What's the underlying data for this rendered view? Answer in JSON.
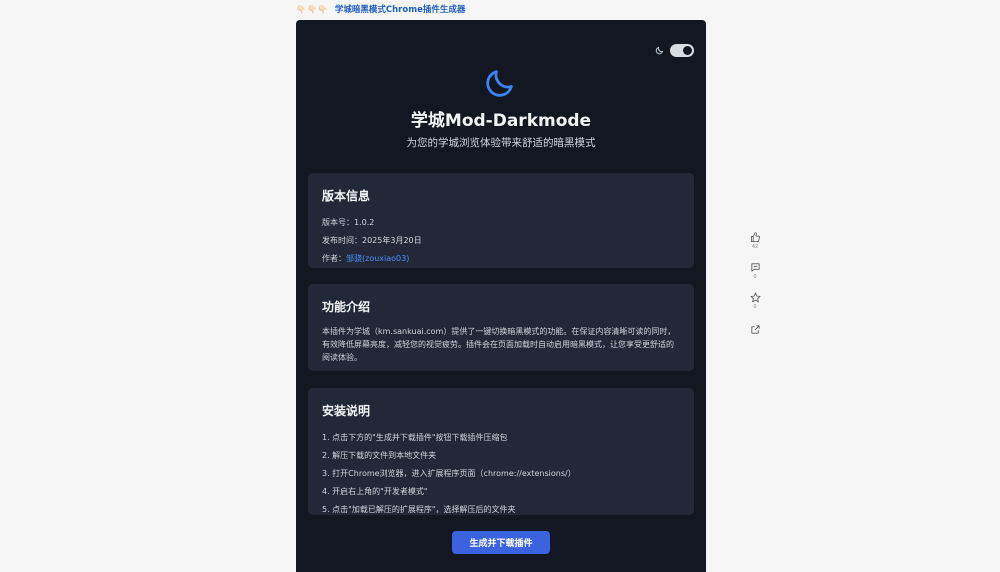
{
  "topbar": {
    "emoji": "👇🏻👇🏻👇🏻",
    "title": "学城暗黑模式Chrome插件生成器"
  },
  "header": {
    "title": "学城Mod-Darkmode",
    "subtitle": "为您的学城浏览体验带来舒适的暗黑模式",
    "toggle_state": "on"
  },
  "version_card": {
    "heading": "版本信息",
    "version_label": "版本号：",
    "version_value": "1.0.2",
    "date_label": "发布时间：",
    "date_value": "2025年3月20日",
    "author_label": "作者：",
    "author_value": "邹骁(zouxiao03)"
  },
  "intro_card": {
    "heading": "功能介绍",
    "text": "本插件为学城（km.sankuai.com）提供了一键切换暗黑模式的功能。在保证内容清晰可读的同时，有效降低屏幕亮度，减轻您的视觉疲劳。插件会在页面加载时自动启用暗黑模式，让您享受更舒适的阅读体验。"
  },
  "install_card": {
    "heading": "安装说明",
    "steps": [
      "1. 点击下方的\"生成并下载插件\"按钮下载插件压缩包",
      "2. 解压下载的文件到本地文件夹",
      "3. 打开Chrome浏览器，进入扩展程序页面（chrome://extensions/）",
      "4. 开启右上角的\"开发者模式\"",
      "5. 点击\"加载已解压的扩展程序\"，选择解压后的文件夹"
    ]
  },
  "download_button": "生成并下载插件",
  "side_actions": {
    "like_count": "42",
    "comment_count": "0",
    "star_count": "0"
  },
  "colors": {
    "panel_bg": "#121722",
    "card_bg": "#222838",
    "accent": "#3b63e0",
    "link": "#4f8ef7"
  }
}
